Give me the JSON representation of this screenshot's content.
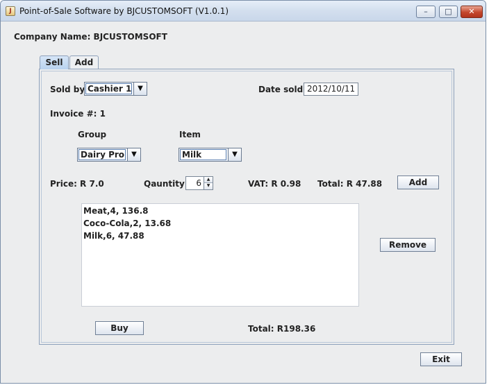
{
  "window": {
    "title": "Point-of-Sale Software by BJCUSTOMSOFT   (V1.0.1)",
    "controls": {
      "minimize": "–",
      "maximize": "□",
      "close": "✕"
    }
  },
  "company": {
    "text": "Company Name: BJCUSTOMSOFT"
  },
  "tabs": [
    {
      "label": "Sell",
      "active": true
    },
    {
      "label": "Add",
      "active": false
    }
  ],
  "sell": {
    "sold_by_label": "Sold by:",
    "sold_by_value": "Cashier 1",
    "date_label": "Date sold:",
    "date_value": "2012/10/11",
    "invoice_text": "Invoice #: 1",
    "group_label": "Group",
    "group_value": "Dairy Pro...",
    "item_label": "Item",
    "item_value": "Milk",
    "price_text": "Price: R 7.0",
    "quantity_label": "Qauntity:",
    "quantity_value": "6",
    "vat_text": "VAT: R 0.98",
    "line_total_text": "Total: R 47.88",
    "add_button": "Add",
    "remove_button": "Remove",
    "list_items": [
      "Meat,4, 136.8",
      "Coco-Cola,2, 13.68",
      "Milk,6, 47.88"
    ],
    "buy_button": "Buy",
    "grand_total_text": "Total: R198.36"
  },
  "footer": {
    "exit_button": "Exit"
  },
  "icons": {
    "dropdown": "▼",
    "spin_up": "▲",
    "spin_down": "▼",
    "app": "J"
  }
}
